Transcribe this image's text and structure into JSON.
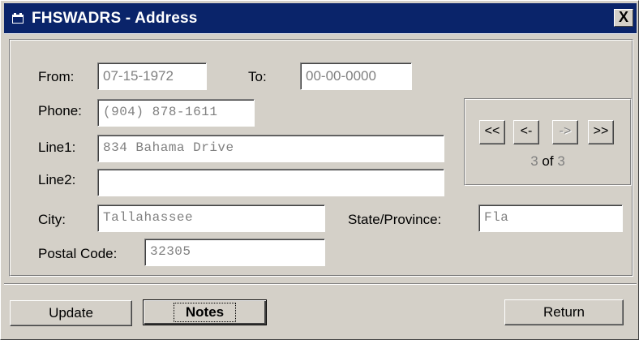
{
  "window": {
    "title": "FHSWADRS - Address",
    "close_label": "X"
  },
  "form": {
    "from_label": "From:",
    "from_value": "07-15-1972",
    "to_label": "To:",
    "to_value": "00-00-0000",
    "phone_label": "Phone:",
    "phone_value": "(904) 878-1611",
    "line1_label": "Line1:",
    "line1_value": "834 Bahama Drive",
    "line2_label": "Line2:",
    "line2_value": "",
    "city_label": "City:",
    "city_value": "Tallahassee",
    "state_label": "State/Province:",
    "state_value": "Fla",
    "postal_label": "Postal Code:",
    "postal_value": "32305"
  },
  "navigator": {
    "first_label": "<<",
    "prev_label": "<-",
    "next_label": "->",
    "last_label": ">>",
    "current": "3",
    "of_label": "of",
    "total": "3"
  },
  "buttons": {
    "update_label": "Update",
    "notes_label": "Notes",
    "return_label": "Return"
  },
  "icons": {
    "app": "app-window-icon",
    "close": "close-icon"
  }
}
